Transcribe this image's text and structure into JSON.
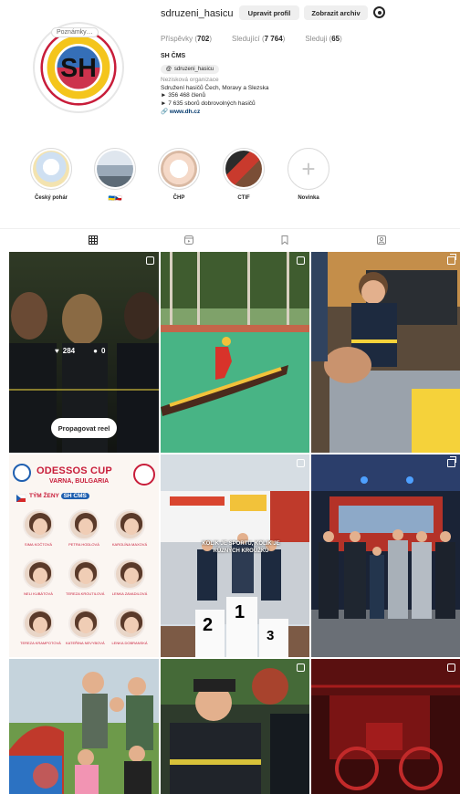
{
  "profile": {
    "username": "sdruzeni_hasicu",
    "edit_label": "Upravit profil",
    "archive_label": "Zobrazit archiv",
    "avatar_badge": "Poznámky…",
    "avatar_initials": "SH",
    "avatar_ring_text": "SDRUŽENÍ HASIČŮ ČECH, MORAVY A SLEZSKA"
  },
  "stats": {
    "posts_label": "Příspěvky",
    "posts_value": "702",
    "followers_label": "Sledující",
    "followers_value": "7 764",
    "following_label": "Sleduji",
    "following_value": "65"
  },
  "bio": {
    "name": "SH ČMS",
    "threads_tag": "sdruzeni_hasicu",
    "category": "Nezisková organizace",
    "line1": "Sdružení hasičů Čech, Moravy a Slezska",
    "line2": "► 356 468 členů",
    "line3": "► 7 635 sborů dobrovolných hasičů",
    "link": "www.dh.cz"
  },
  "highlights": [
    {
      "label": "Český pohár"
    },
    {
      "label": "🇺🇦🇨🇿"
    },
    {
      "label": "ČHP"
    },
    {
      "label": "CTIF"
    },
    {
      "label": "Novinka"
    }
  ],
  "posts": {
    "reel_likes": "284",
    "reel_comments": "0",
    "promote_label": "Propagovat reel",
    "odessos_title": "ODESSOS CUP",
    "odessos_sub": "VARNA, BULGARIA",
    "odessos_cat": "TÝM ŽENY",
    "odessos_badge": "SH ČMS",
    "odessos_people": [
      "SIMA KOČTOVÁ",
      "PETRA HODLOVÁ",
      "KAROLÍNA MAXOVÁ",
      "NELI KUBÁTOVÁ",
      "TEREZA KROUTILOVÁ",
      "LENKA ZAVADILOVÁ",
      "TEREZA KRAMPOTOVÁ",
      "KATEŘINA NEVYBOVÁ",
      "LENKA DOBRANSKÁ"
    ],
    "stimul_text": "KOLIK JE SPORTU, KOLIK JE RŮZNÝCH KROUŽKŮ",
    "podium": [
      "2",
      "1",
      "3"
    ]
  },
  "colors": {
    "accent_red": "#c81d3a",
    "link_blue": "#00376b",
    "badge_blue": "#1f5fb0"
  }
}
